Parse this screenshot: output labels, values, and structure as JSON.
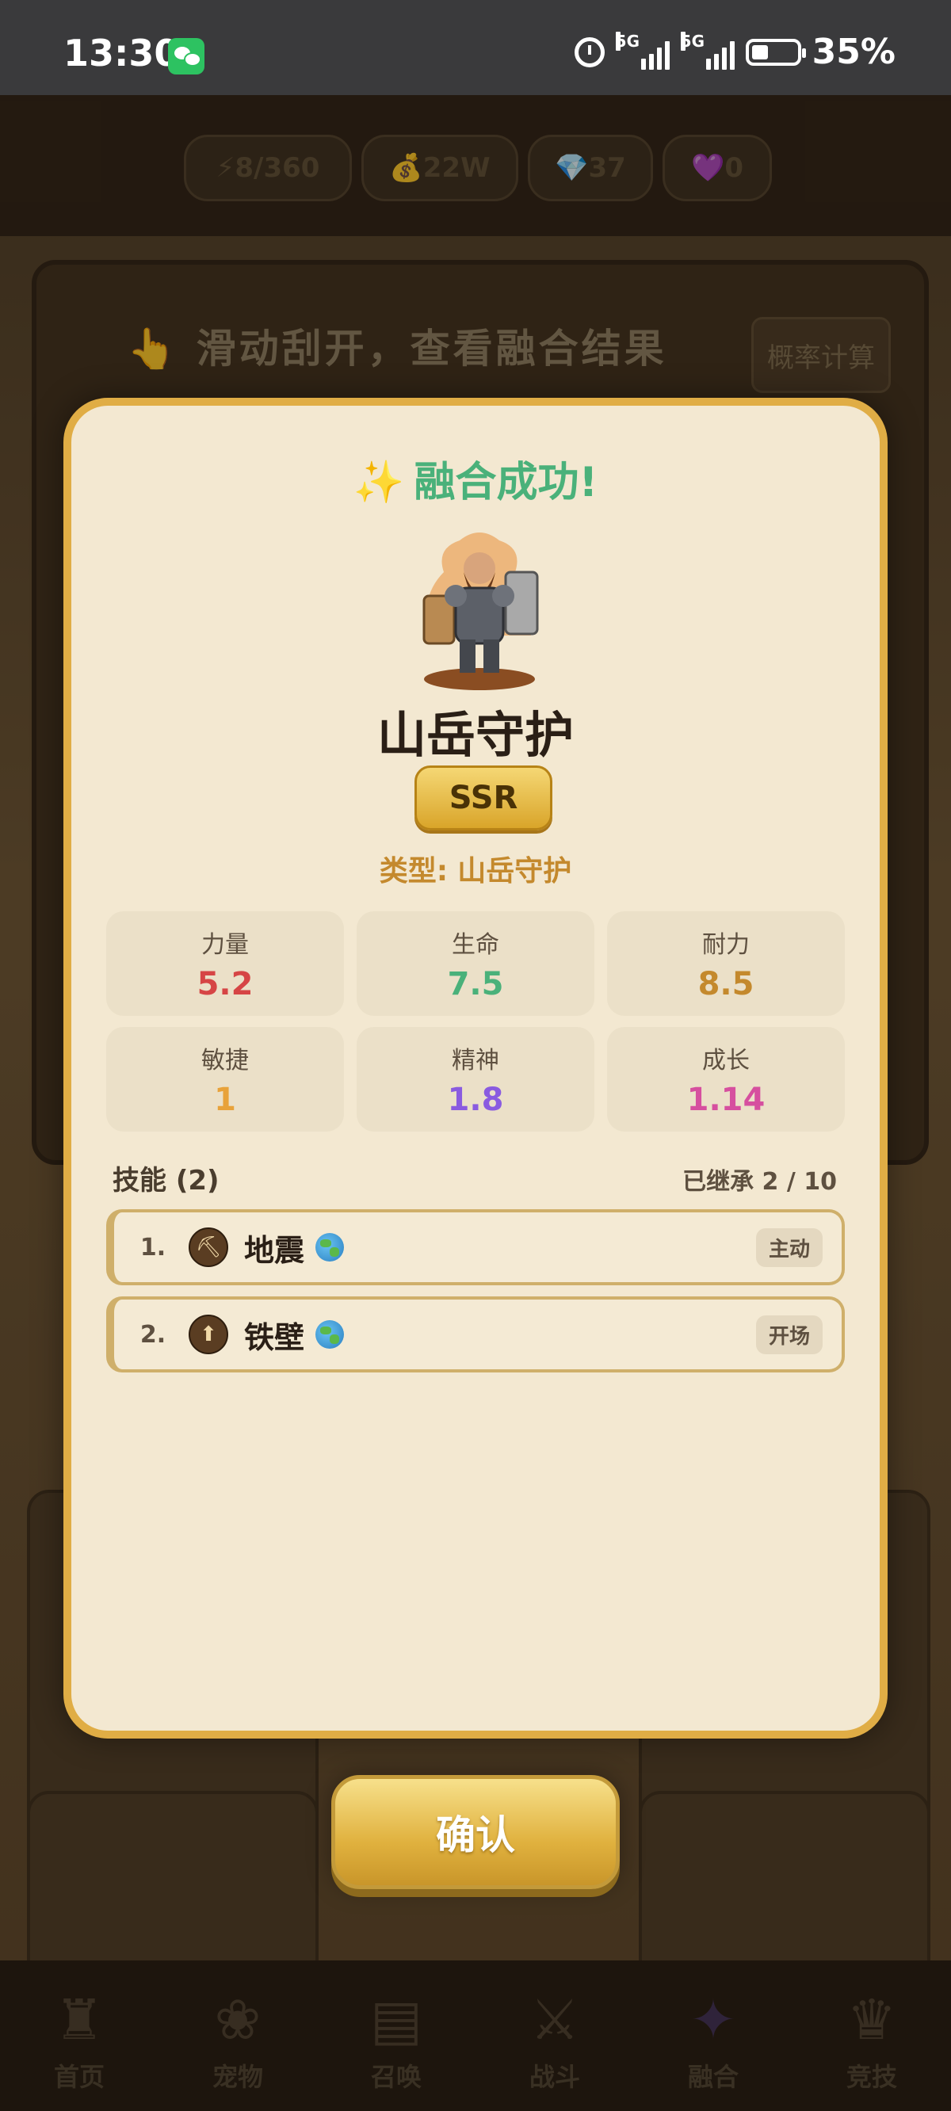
{
  "status_bar": {
    "time": "13:30",
    "network_1": "5G",
    "network_2": "5G",
    "battery": "35%",
    "icons": [
      "wechat-icon",
      "alarm-icon",
      "signal-icon",
      "battery-icon"
    ]
  },
  "resources": {
    "energy": "⚡8/360",
    "gold": "💰22W",
    "gems": "💎37",
    "hearts": "💜0"
  },
  "background": {
    "scratch_hint": "👆 滑动刮开，查看融合结果",
    "probability_button": "概率计算",
    "nav": [
      {
        "label": "首页",
        "icon": "castle-icon"
      },
      {
        "label": "宠物",
        "icon": "paw-icon"
      },
      {
        "label": "召唤",
        "icon": "scroll-icon"
      },
      {
        "label": "战斗",
        "icon": "crossed-swords-icon"
      },
      {
        "label": "融合",
        "icon": "dragon-icon"
      },
      {
        "label": "竞技",
        "icon": "trophy-icon"
      }
    ]
  },
  "result": {
    "title": "融合成功!",
    "sparkle": "✨",
    "hero_name": "山岳守护",
    "rarity": "SSR",
    "type_label": "类型:",
    "type_value": "山岳守护",
    "stats": [
      {
        "label": "力量",
        "value": "5.2",
        "color": "#d64545"
      },
      {
        "label": "生命",
        "value": "7.5",
        "color": "#4ab17a"
      },
      {
        "label": "耐力",
        "value": "8.5",
        "color": "#c4892d"
      },
      {
        "label": "敏捷",
        "value": "1",
        "color": "#e8a23a"
      },
      {
        "label": "精神",
        "value": "1.8",
        "color": "#8a5be0"
      },
      {
        "label": "成长",
        "value": "1.14",
        "color": "#d64f9f"
      }
    ],
    "skills_heading": "技能 (2)",
    "inherited": "已继承 2 / 10",
    "skills": [
      {
        "index": "1.",
        "name": "地震",
        "tag": "主动",
        "icon": "pickaxe-icon"
      },
      {
        "index": "2.",
        "name": "铁壁",
        "tag": "开场",
        "icon": "shield-arrow-icon"
      }
    ],
    "confirm_label": "确认"
  }
}
